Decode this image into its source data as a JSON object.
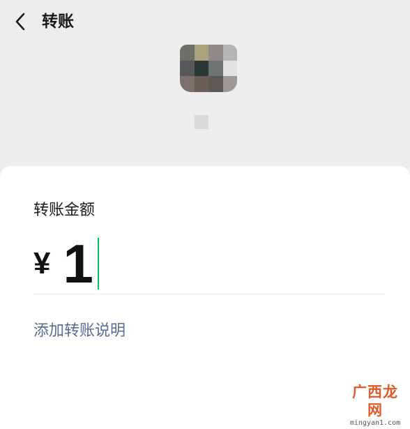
{
  "header": {
    "title": "转账",
    "back_icon": "chevron-left-icon"
  },
  "recipient": {
    "avatar_blurred": true,
    "name_blurred": true
  },
  "form": {
    "amount_label": "转账金额",
    "currency_symbol": "¥",
    "amount_value": "1",
    "add_note_label": "添加转账说明"
  },
  "watermark": {
    "text": "广西龙网",
    "url": "mingyan1.com"
  },
  "colors": {
    "background": "#ededed",
    "card": "#ffffff",
    "link": "#576b95",
    "caret": "#07c160",
    "watermark": "#e05a2a"
  }
}
